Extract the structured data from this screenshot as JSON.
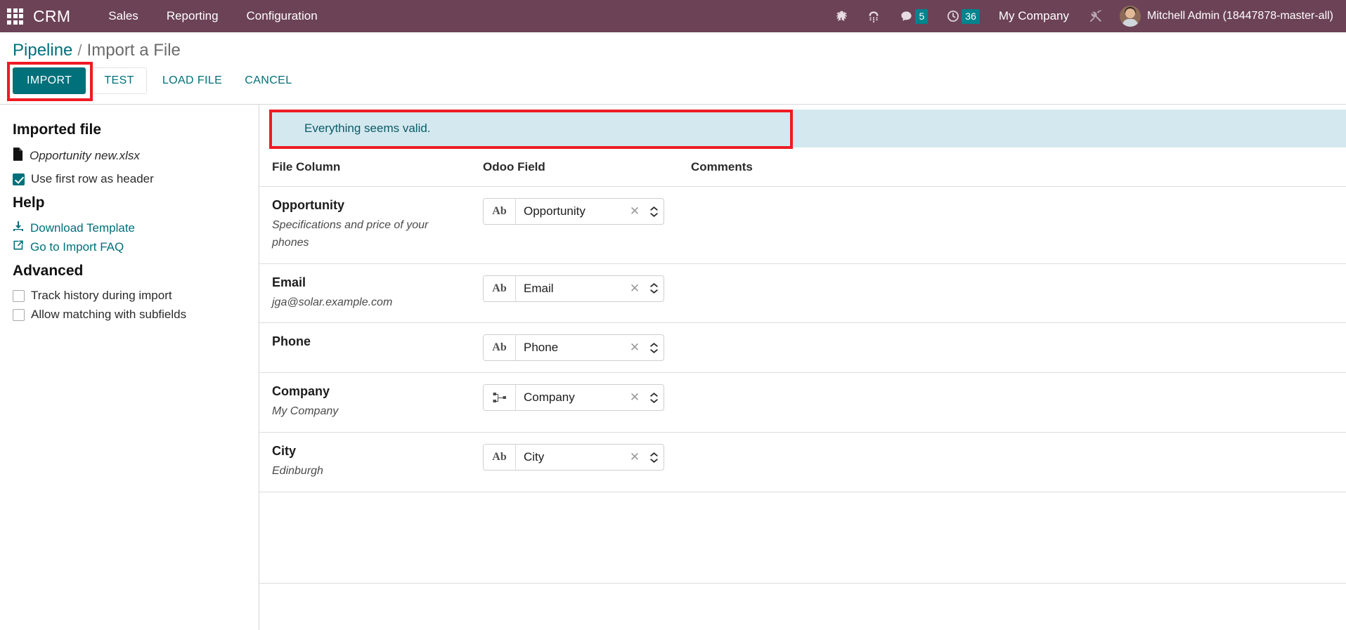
{
  "navbar": {
    "apps_icon": "apps-grid-icon",
    "brand": "CRM",
    "menu": [
      {
        "label": "Sales"
      },
      {
        "label": "Reporting"
      },
      {
        "label": "Configuration"
      }
    ],
    "sys_icons": [
      {
        "name": "bug-icon",
        "badge": null
      },
      {
        "name": "phone-dialpad-icon",
        "badge": null
      },
      {
        "name": "messaging-chat-icon",
        "badge": "5"
      },
      {
        "name": "activity-clock-icon",
        "badge": "36"
      }
    ],
    "company": "My Company",
    "tools_icon": "tools-wrench-icon",
    "user": "Mitchell Admin (18447878-master-all)",
    "accent_purple": "#6c4257",
    "badge_teal": "#00848e"
  },
  "breadcrumb": {
    "root": "Pipeline",
    "separator": "/",
    "current": "Import a File"
  },
  "actions": {
    "import": "IMPORT",
    "test": "TEST",
    "load_file": "LOAD FILE",
    "cancel": "CANCEL",
    "highlight_color": "#ee1b24",
    "primary_color": "#00707a"
  },
  "sidebar": {
    "imported_file_heading": "Imported file",
    "file_icon": "file-document-icon",
    "file_name": "Opportunity new.xlsx",
    "use_first_row": {
      "label": "Use first row as header",
      "checked": true
    },
    "help_heading": "Help",
    "help_links": [
      {
        "icon": "download-icon",
        "label": "Download Template"
      },
      {
        "icon": "external-link-icon",
        "label": "Go to Import FAQ"
      }
    ],
    "advanced_heading": "Advanced",
    "advanced_options": [
      {
        "label": "Track history during import",
        "checked": false
      },
      {
        "label": "Allow matching with subfields",
        "checked": false
      }
    ]
  },
  "main": {
    "alert": {
      "message": "Everything seems valid.",
      "background": "#d4e9ef",
      "text_color": "#0b5a67"
    },
    "table": {
      "headers": {
        "file_column": "File Column",
        "odoo_field": "Odoo Field",
        "comments": "Comments"
      },
      "rows": [
        {
          "column": "Opportunity",
          "sample": "Specifications and price of your phones",
          "field_icon": "text-ab-icon",
          "field_icon_glyph": "Ab",
          "field_value": "Opportunity",
          "clear_icon": "clear-x-icon",
          "stepper_icon": "chevron-updown-icon",
          "comment": ""
        },
        {
          "column": "Email",
          "sample": "jga@solar.example.com",
          "field_icon": "text-ab-icon",
          "field_icon_glyph": "Ab",
          "field_value": "Email",
          "clear_icon": "clear-x-icon",
          "stepper_icon": "chevron-updown-icon",
          "comment": ""
        },
        {
          "column": "Phone",
          "sample": "",
          "field_icon": "text-ab-icon",
          "field_icon_glyph": "Ab",
          "field_value": "Phone",
          "clear_icon": "clear-x-icon",
          "stepper_icon": "chevron-updown-icon",
          "comment": ""
        },
        {
          "column": "Company",
          "sample": "My Company",
          "field_icon": "relation-many2one-icon",
          "field_icon_glyph": "",
          "field_value": "Company",
          "clear_icon": "clear-x-icon",
          "stepper_icon": "chevron-updown-icon",
          "comment": ""
        },
        {
          "column": "City",
          "sample": "Edinburgh",
          "field_icon": "text-ab-icon",
          "field_icon_glyph": "Ab",
          "field_value": "City",
          "clear_icon": "clear-x-icon",
          "stepper_icon": "chevron-updown-icon",
          "comment": ""
        }
      ]
    }
  }
}
